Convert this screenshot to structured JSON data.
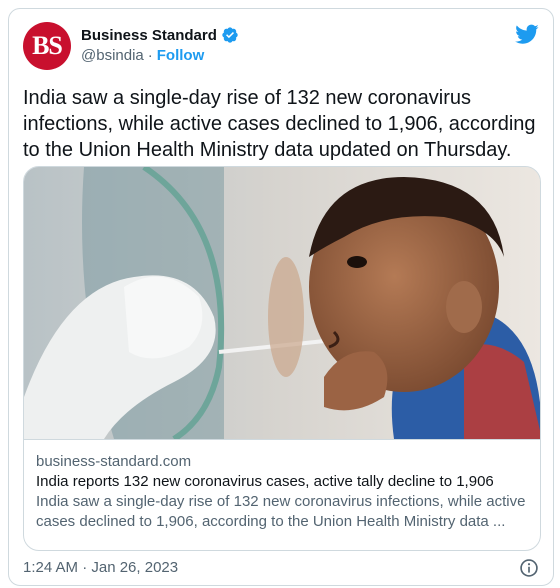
{
  "account": {
    "avatar_text": "BS",
    "name": "Business Standard",
    "handle": "@bsindia",
    "separator": "·",
    "follow_label": "Follow"
  },
  "tweet": {
    "text": "India saw a single-day rise of 132 new coronavirus infections, while active cases declined to 1,906, according to the Union Health Ministry data updated on Thursday."
  },
  "link_card": {
    "domain": "business-standard.com",
    "title": "India reports 132 new coronavirus cases, active tally decline to 1,906",
    "description": "India saw a single-day rise of 132 new coronavirus infections, while active cases declined to 1,906, according to the Union Health Ministry data ..."
  },
  "footer": {
    "timestamp": "1:24 AM · Jan 26, 2023"
  },
  "icons": {
    "verified": "verified-badge-icon",
    "platform": "twitter-bird-icon",
    "info": "info-icon"
  },
  "colors": {
    "brand_red": "#c8102e",
    "accent_blue": "#1d9bf0",
    "muted_text": "#536471",
    "border": "#cfd9de"
  }
}
